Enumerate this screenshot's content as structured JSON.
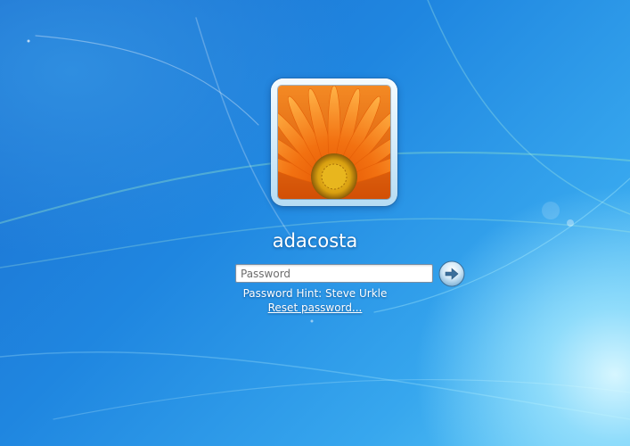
{
  "user": {
    "name": "adacosta",
    "tile_icon": "user-picture-orange-flower"
  },
  "login": {
    "password_placeholder": "Password",
    "password_value": "",
    "hint_text": "Password Hint: Steve Urkle",
    "reset_link": "Reset password...",
    "submit_icon": "arrow-right-icon"
  },
  "colors": {
    "background": "#1f86e0",
    "text": "#ffffff",
    "accent_orange": "#f26a0f"
  }
}
